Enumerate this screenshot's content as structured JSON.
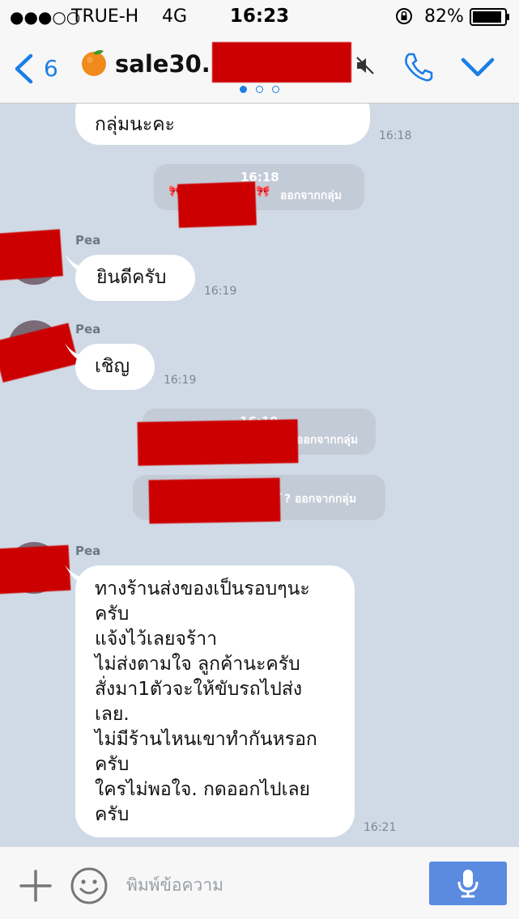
{
  "status_bar": {
    "signal": "●●●○○",
    "carrier": "TRUE-H",
    "network": "4G",
    "time": "16:23",
    "battery": "82%"
  },
  "nav": {
    "back_count": "6",
    "title": "sale30..",
    "emoji": "🍊",
    "accent_color": "#1a7ee6"
  },
  "messages": [
    {
      "type": "incoming",
      "text": "กลุ่มนะคะ",
      "time": "16:18"
    },
    {
      "type": "system",
      "time": "16:18",
      "text": "ออกจากกลุ่ม",
      "prefix": "🎀"
    },
    {
      "type": "incoming",
      "sender": "Pea",
      "text": "ยินดีครับ",
      "time": "16:19"
    },
    {
      "type": "incoming",
      "sender": "Pea",
      "text": "เชิญ",
      "time": "16:19"
    },
    {
      "type": "system",
      "time": "16:19",
      "text": "ออกจากกลุ่ม"
    },
    {
      "type": "system",
      "text": "`? ออกจากกลุ่ม"
    },
    {
      "type": "incoming",
      "sender": "Pea",
      "text": "ทางร้านส่งของเป็นรอบๆนะ\nครับ\nแจ้งไว้เลยจร้าา\nไม่ส่งตามใจ ลูกค้านะครับ\nสั่งมา1ตัวจะให้ขับรถไปส่ง\nเลย.\nไม่มีร้านไหนเขาทำกันหรอก\nครับ\nใครไม่พอใจ. กดออกไปเลย\nครับ",
      "time": "16:21"
    }
  ],
  "input": {
    "placeholder": "พิมพ์ข้อความ"
  },
  "colors": {
    "chat_bg": "#d0dae6",
    "redaction": "#cc0000",
    "mic_button": "#5b8be0"
  }
}
